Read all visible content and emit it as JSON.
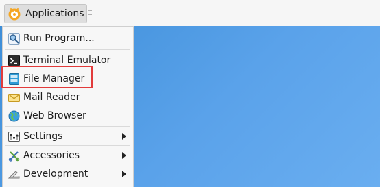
{
  "panel": {
    "applications_label": "Applications",
    "applications_icon": "xfce-mouse-logo-icon"
  },
  "menu": {
    "items": [
      {
        "label": "Run Program...",
        "icon": "run-program-icon",
        "submenu": false
      },
      {
        "label": "Terminal Emulator",
        "icon": "terminal-icon",
        "submenu": false
      },
      {
        "label": "File Manager",
        "icon": "file-manager-icon",
        "submenu": false,
        "highlighted": true
      },
      {
        "label": "Mail Reader",
        "icon": "mail-icon",
        "submenu": false
      },
      {
        "label": "Web Browser",
        "icon": "web-browser-icon",
        "submenu": false
      },
      {
        "label": "Settings",
        "icon": "settings-icon",
        "submenu": true
      },
      {
        "label": "Accessories",
        "icon": "accessories-icon",
        "submenu": true
      },
      {
        "label": "Development",
        "icon": "development-icon",
        "submenu": true
      }
    ]
  },
  "colors": {
    "highlight_border": "#e23b3b",
    "desktop_blue": "#4f9be4"
  }
}
